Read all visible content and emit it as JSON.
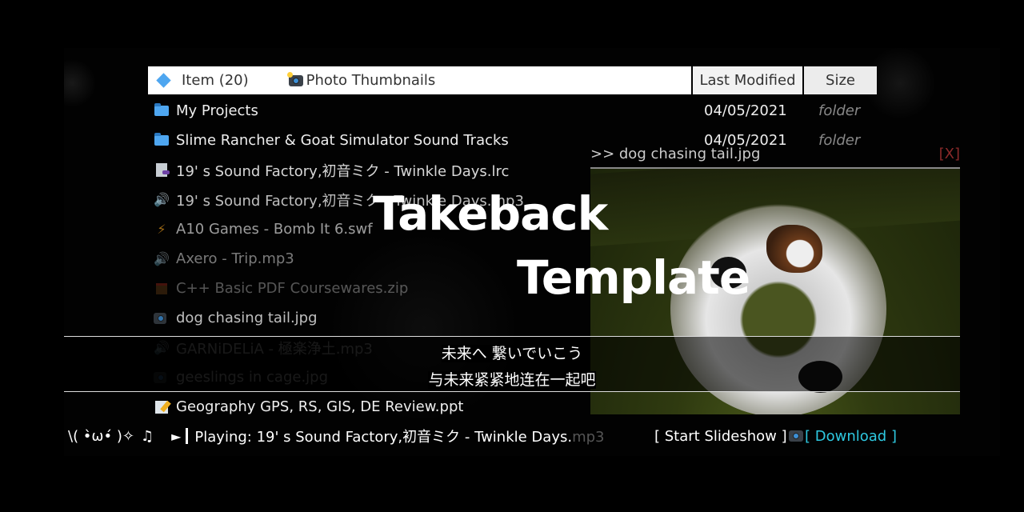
{
  "header": {
    "item_label": "Item (20)",
    "photo_thumbnails_label": "Photo Thumbnails",
    "last_modified_label": "Last Modified",
    "size_label": "Size"
  },
  "files": [
    {
      "icon": "folder-icon",
      "name": "My Projects",
      "modified": "04/05/2021",
      "size": "folder",
      "opacity": 1
    },
    {
      "icon": "folder-icon",
      "name": "Slime Rancher & Goat Simulator Sound Tracks",
      "modified": "04/05/2021",
      "size": "folder",
      "opacity": 1
    },
    {
      "icon": "lyrics-file-icon",
      "name": "19' s Sound Factory,初音ミク - Twinkle Days.lrc",
      "modified": "",
      "size": "",
      "opacity": 0.9
    },
    {
      "icon": "speaker-icon",
      "name": "19' s Sound Factory,初音ミク - Twinkle Days.mp3",
      "modified": "",
      "size": "",
      "opacity": 0.8
    },
    {
      "icon": "lightning-icon",
      "name": "A10 Games - Bomb It 6.swf",
      "modified": "",
      "size": "",
      "opacity": 0.65
    },
    {
      "icon": "speaker-icon",
      "name": "Axero - Trip.mp3",
      "modified": "",
      "size": "",
      "opacity": 0.5
    },
    {
      "icon": "gift-icon",
      "name": "C++ Basic PDF Coursewares.zip",
      "modified": "",
      "size": "",
      "opacity": 0.35
    },
    {
      "icon": "camera-icon",
      "name": "dog chasing tail.jpg",
      "modified": "",
      "size": "",
      "opacity": 0.8
    },
    {
      "icon": "speaker-icon",
      "name": "GARNiDELiA - 極楽浄土.mp3",
      "modified": "",
      "size": "",
      "opacity": 0.22
    },
    {
      "icon": "camera-icon",
      "name": "geeslings in cage.jpg",
      "modified": "",
      "size": "",
      "opacity": 0.22
    },
    {
      "icon": "memo-icon",
      "name": "Geography GPS, RS, GIS, DE Review.ppt",
      "modified": "",
      "size": "",
      "opacity": 1
    }
  ],
  "preview": {
    "title": ">> dog chasing tail.jpg",
    "close_label": "[X]"
  },
  "overlay_title": {
    "line1": "Takeback",
    "line2": "Template"
  },
  "lyrics": {
    "line1": "未来へ 繋いでいこう",
    "line2": "与未来紧紧地连在一起吧"
  },
  "player": {
    "kaomoji": "\\( •̀ω•́ )✧",
    "note": "♫",
    "play_symbol": "►",
    "playing_prefix": "Playing: ",
    "track_played": "19' s Sound Factory,初音ミク - Twinkle Days.",
    "track_rest": "mp3",
    "progress_fraction": 0.93
  },
  "actions": {
    "slideshow_label": "[ Start Slideshow ]",
    "download_label": "[ Download ]"
  },
  "colors": {
    "accent_blue": "#4ea6f0",
    "download_cyan": "#2ec8e0",
    "close_red": "#8a2a2a"
  }
}
